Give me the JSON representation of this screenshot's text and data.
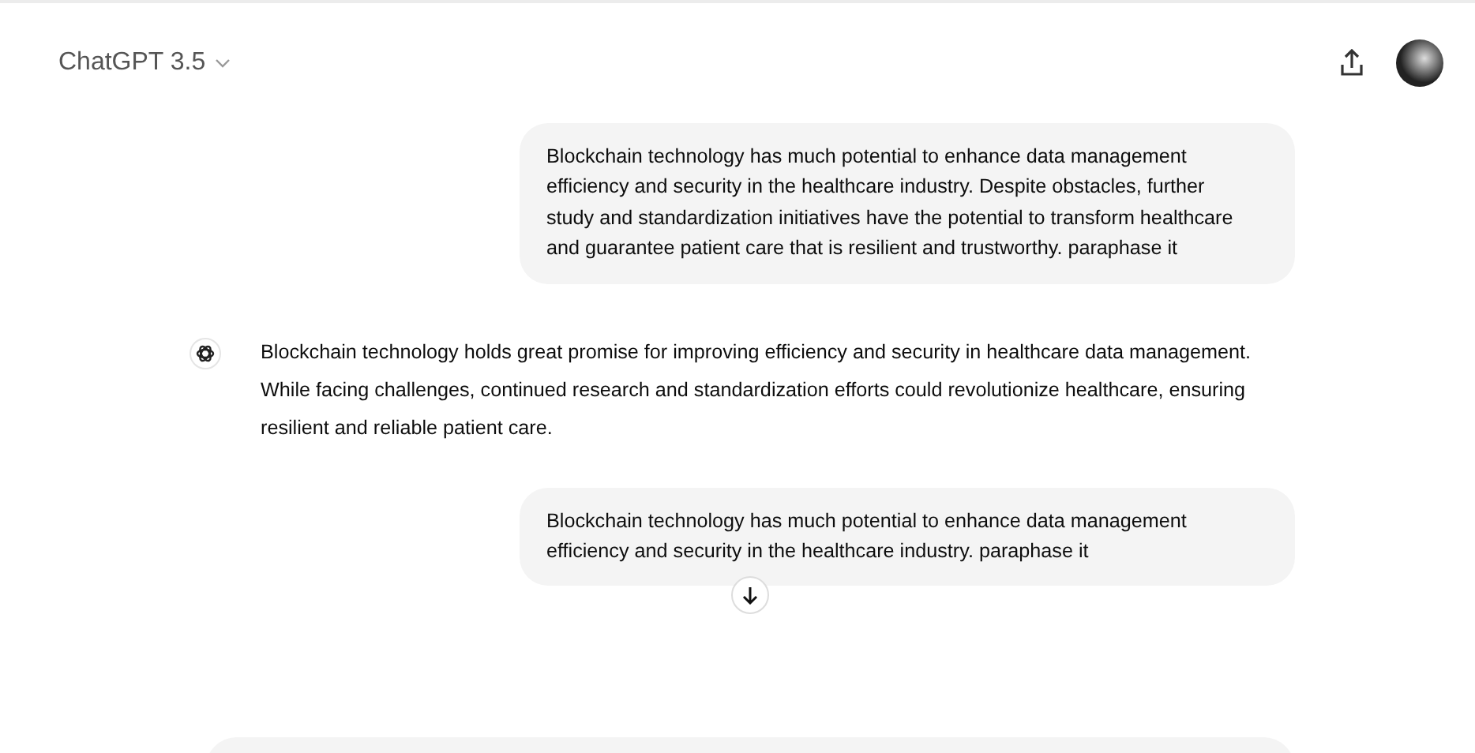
{
  "header": {
    "model": "ChatGPT 3.5"
  },
  "messages": [
    {
      "kind": "user",
      "text": "Blockchain technology has much potential to enhance data management efficiency and security in the healthcare industry. Despite obstacles, further study and standardization initiatives have the potential to transform healthcare and guarantee patient care that is resilient and trustworthy.  paraphase it"
    },
    {
      "kind": "assistant",
      "text": "Blockchain technology holds great promise for improving efficiency and security in healthcare data management. While facing challenges, continued research and standardization efforts could revolutionize healthcare, ensuring resilient and reliable patient care."
    },
    {
      "kind": "user",
      "text": "Blockchain technology has much potential to enhance data management efficiency and security in the healthcare industry. paraphase it"
    }
  ]
}
